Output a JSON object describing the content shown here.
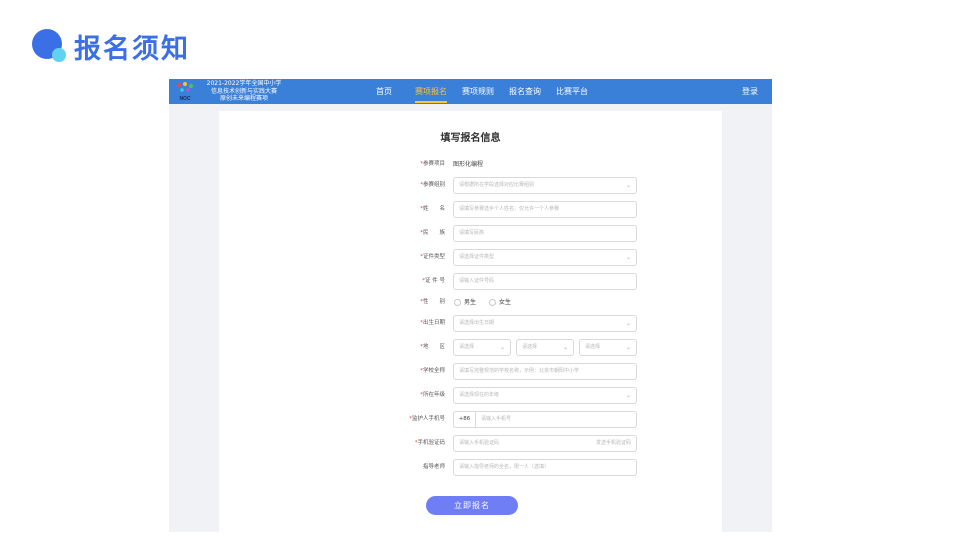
{
  "slide": {
    "title": "报名须知"
  },
  "navbar": {
    "logo_text": "NOC",
    "title_lines": [
      "2021-2022学年全国中小学",
      "信息技术创新与实践大赛",
      "原创未来编程赛项"
    ],
    "items": [
      "首页",
      "赛项报名",
      "赛项规则",
      "报名查询",
      "比赛平台"
    ],
    "active_index": 1,
    "login": "登录",
    "colors": {
      "bar": "#3a7fd8",
      "active": "#ffc23a"
    }
  },
  "form": {
    "title": "填写报名信息",
    "fields": {
      "project": {
        "label": "参赛项目",
        "value": "图形化编程"
      },
      "group": {
        "label": "参赛组别",
        "placeholder": "请根据所在学段选择对应比赛组别"
      },
      "name": {
        "label": "姓　　名",
        "placeholder": "请填写参赛选手个人姓名，仅允许一个人参赛"
      },
      "ethnicity": {
        "label": "民　　族",
        "placeholder": "请填写民族"
      },
      "id_type": {
        "label": "证件类型",
        "placeholder": "请选择证件类型"
      },
      "id_number": {
        "label": "证 件 号",
        "placeholder": "请输入证件号码"
      },
      "gender": {
        "label": "性　　别",
        "options": [
          "男生",
          "女生"
        ]
      },
      "birth": {
        "label": "出生日期",
        "placeholder": "请选择出生日期"
      },
      "region": {
        "label": "地　　区",
        "placeholders": [
          "请选择",
          "请选择",
          "请选择"
        ]
      },
      "school": {
        "label": "学校全称",
        "placeholder": "请填写完整规范的学校名称，示例：北京市朝阳中小学"
      },
      "grade": {
        "label": "所在年级",
        "placeholder": "请选择现在的年级"
      },
      "guardian_phone": {
        "label": "监护人手机号",
        "prefix": "+86",
        "placeholder": "请输入手机号"
      },
      "sms_code": {
        "label": "手机验证码",
        "placeholder": "请输入手机验证码",
        "action": "发送手机验证码"
      },
      "teacher": {
        "label": "指导老师",
        "placeholder": "请输入指导老师的全名，限一人（选填）"
      }
    },
    "submit": "立即报名",
    "accent": "#6f7ef5"
  }
}
